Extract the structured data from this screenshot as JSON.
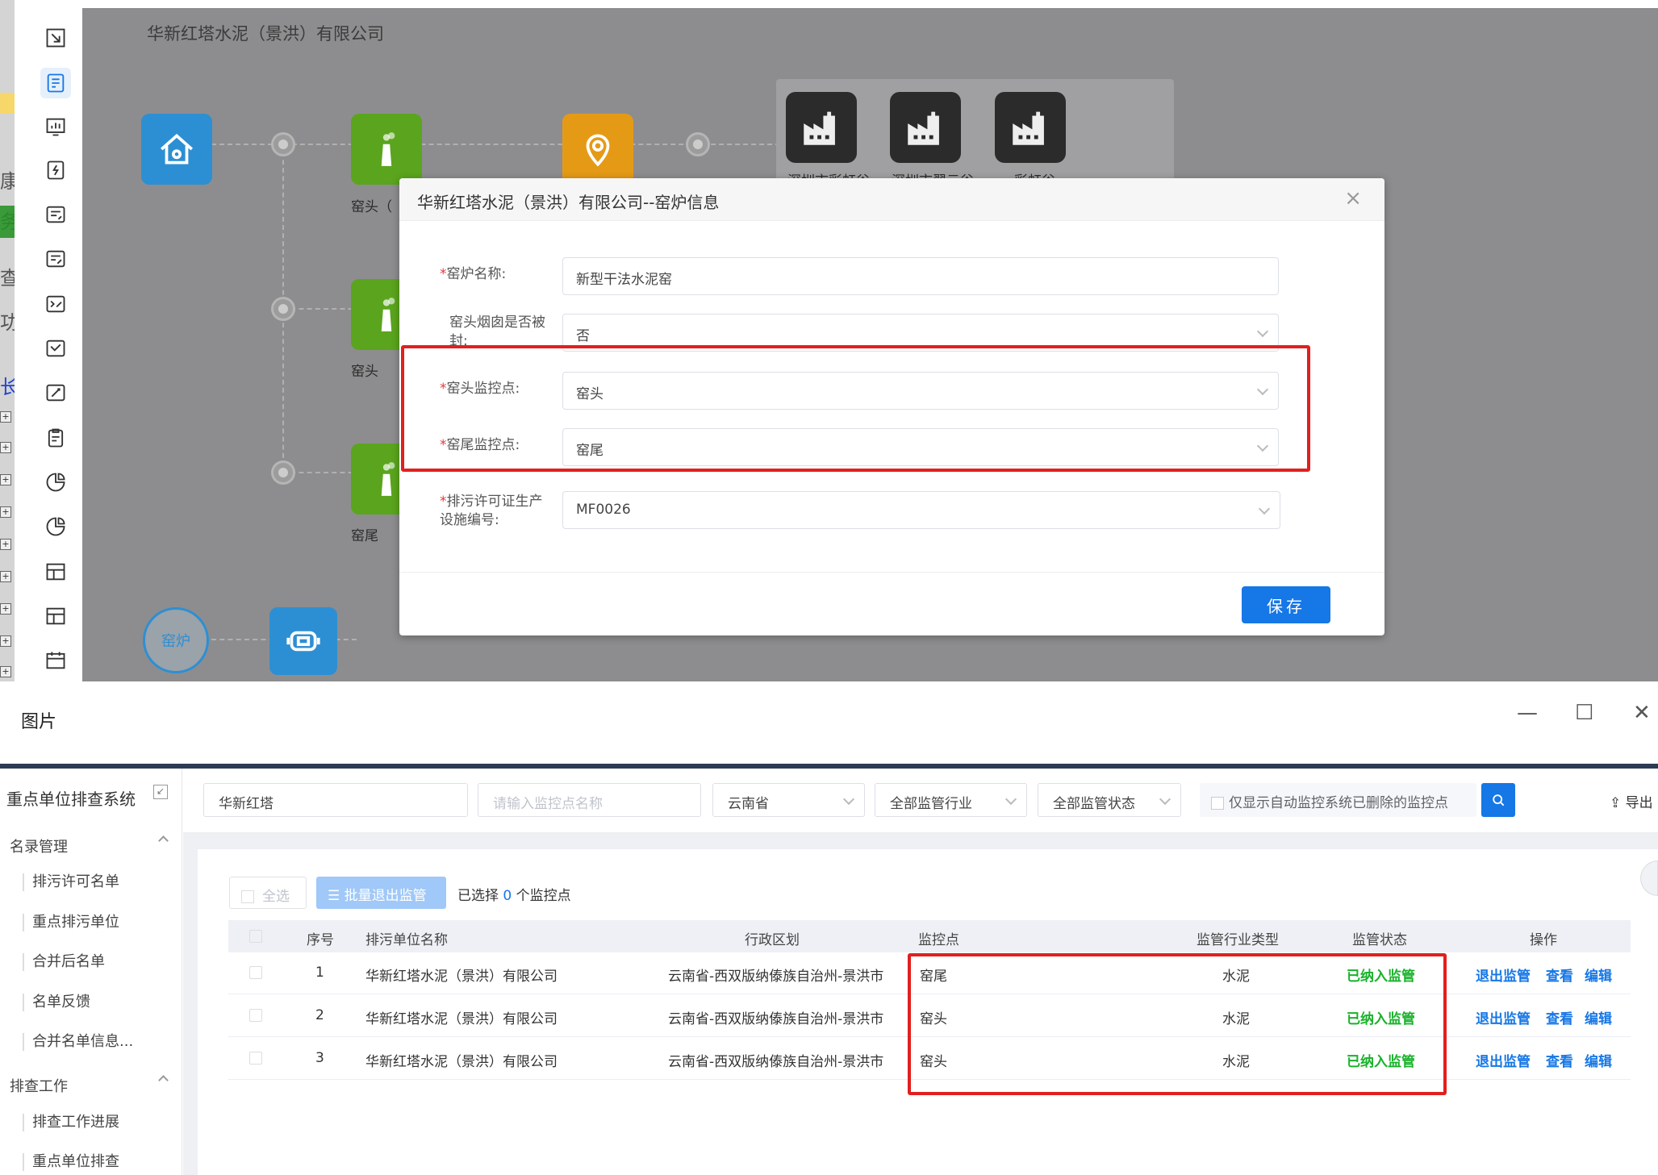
{
  "top": {
    "company_title": "华新红塔水泥（景洪）有限公司",
    "nodes": {
      "kiln_head_1": "窑头（",
      "kiln_head_2": "窑头",
      "kiln_tail": "窑尾",
      "kiln_circle": "窑炉"
    },
    "factories": [
      "深圳市彩虹谷",
      "深圳市翠云谷",
      "彩虹谷"
    ],
    "left_strip_chars": [
      "康",
      "务",
      "查",
      "功",
      "长"
    ]
  },
  "modal": {
    "title": "华新红塔水泥（景洪）有限公司--窑炉信息",
    "close": "×",
    "fields": [
      {
        "label": "窑炉名称:",
        "required": true,
        "value": "新型干法水泥窑"
      },
      {
        "label": "窑头烟囱是否被封:",
        "required": false,
        "value": "否"
      },
      {
        "label": "窑头监控点:",
        "required": true,
        "value": "窑头"
      },
      {
        "label": "窑尾监控点:",
        "required": true,
        "value": "窑尾"
      },
      {
        "label": "排污许可证生产设施编号:",
        "required": true,
        "value": "MF0026"
      }
    ],
    "required_mark": "*",
    "save": "保存"
  },
  "window": {
    "title": "图片",
    "minimize": "—",
    "maximize": "☐",
    "close": "✕"
  },
  "sidebar": {
    "title": "重点单位排查系统",
    "collapse_glyph": "↙",
    "group1": "名录管理",
    "group1_items": [
      "排污许可名单",
      "重点排污单位",
      "合并后名单",
      "名单反馈",
      "合并名单信息..."
    ],
    "group2": "排查工作",
    "group2_items": [
      "排查工作进展",
      "重点单位排查"
    ]
  },
  "filters": {
    "company": "华新红塔",
    "monitor_placeholder": "请输入监控点名称",
    "province": "云南省",
    "industry": "全部监管行业",
    "status": "全部监管状态",
    "checkbox_label": "仅显示自动监控系统已删除的监控点",
    "export": "导出"
  },
  "toolbar": {
    "select_all": "全选",
    "batch_exit": "批量退出监管",
    "selected_prefix": "已选择",
    "selected_count": "0",
    "selected_suffix": "个监控点"
  },
  "table": {
    "columns": [
      "序号",
      "排污单位名称",
      "行政区划",
      "监控点",
      "监管行业类型",
      "监管状态",
      "操作"
    ],
    "rows": [
      {
        "no": "1",
        "name": "华新红塔水泥（景洪）有限公司",
        "region": "云南省-西双版纳傣族自治州-景洪市",
        "point": "窑尾",
        "industry": "水泥",
        "status": "已纳入监管",
        "a1": "退出监管",
        "a2": "查看",
        "a3": "编辑"
      },
      {
        "no": "2",
        "name": "华新红塔水泥（景洪）有限公司",
        "region": "云南省-西双版纳傣族自治州-景洪市",
        "point": "窑头",
        "industry": "水泥",
        "status": "已纳入监管",
        "a1": "退出监管",
        "a2": "查看",
        "a3": "编辑"
      },
      {
        "no": "3",
        "name": "华新红塔水泥（景洪）有限公司",
        "region": "云南省-西双版纳傣族自治州-景洪市",
        "point": "窑头",
        "industry": "水泥",
        "status": "已纳入监管",
        "a1": "退出监管",
        "a2": "查看",
        "a3": "编辑"
      }
    ]
  },
  "colors": {
    "primary": "#1677e6",
    "highlight_red": "#e21f1f",
    "status_green": "#19b22b",
    "canvas_gray": "#8d8d8f"
  }
}
